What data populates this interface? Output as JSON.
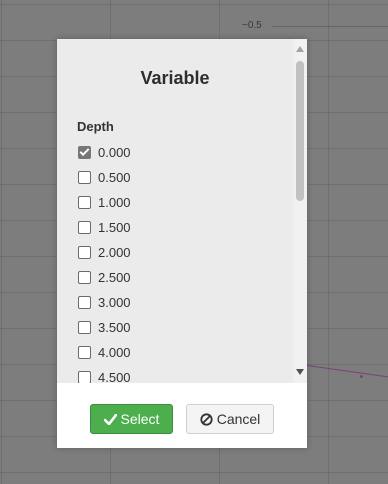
{
  "background": {
    "tick_label": "−0.5"
  },
  "dialog": {
    "title": "Variable",
    "group_label": "Depth",
    "options": [
      {
        "label": "0.000",
        "checked": true
      },
      {
        "label": "0.500",
        "checked": false
      },
      {
        "label": "1.000",
        "checked": false
      },
      {
        "label": "1.500",
        "checked": false
      },
      {
        "label": "2.000",
        "checked": false
      },
      {
        "label": "2.500",
        "checked": false
      },
      {
        "label": "3.000",
        "checked": false
      },
      {
        "label": "3.500",
        "checked": false
      },
      {
        "label": "4.000",
        "checked": false
      },
      {
        "label": "4.500",
        "checked": false
      }
    ],
    "buttons": {
      "select_label": "Select",
      "cancel_label": "Cancel"
    }
  },
  "colors": {
    "select_button": "#4cae4c",
    "panel": "#ebebeb"
  },
  "icons": {
    "select": "check-icon",
    "cancel": "ban-icon"
  }
}
